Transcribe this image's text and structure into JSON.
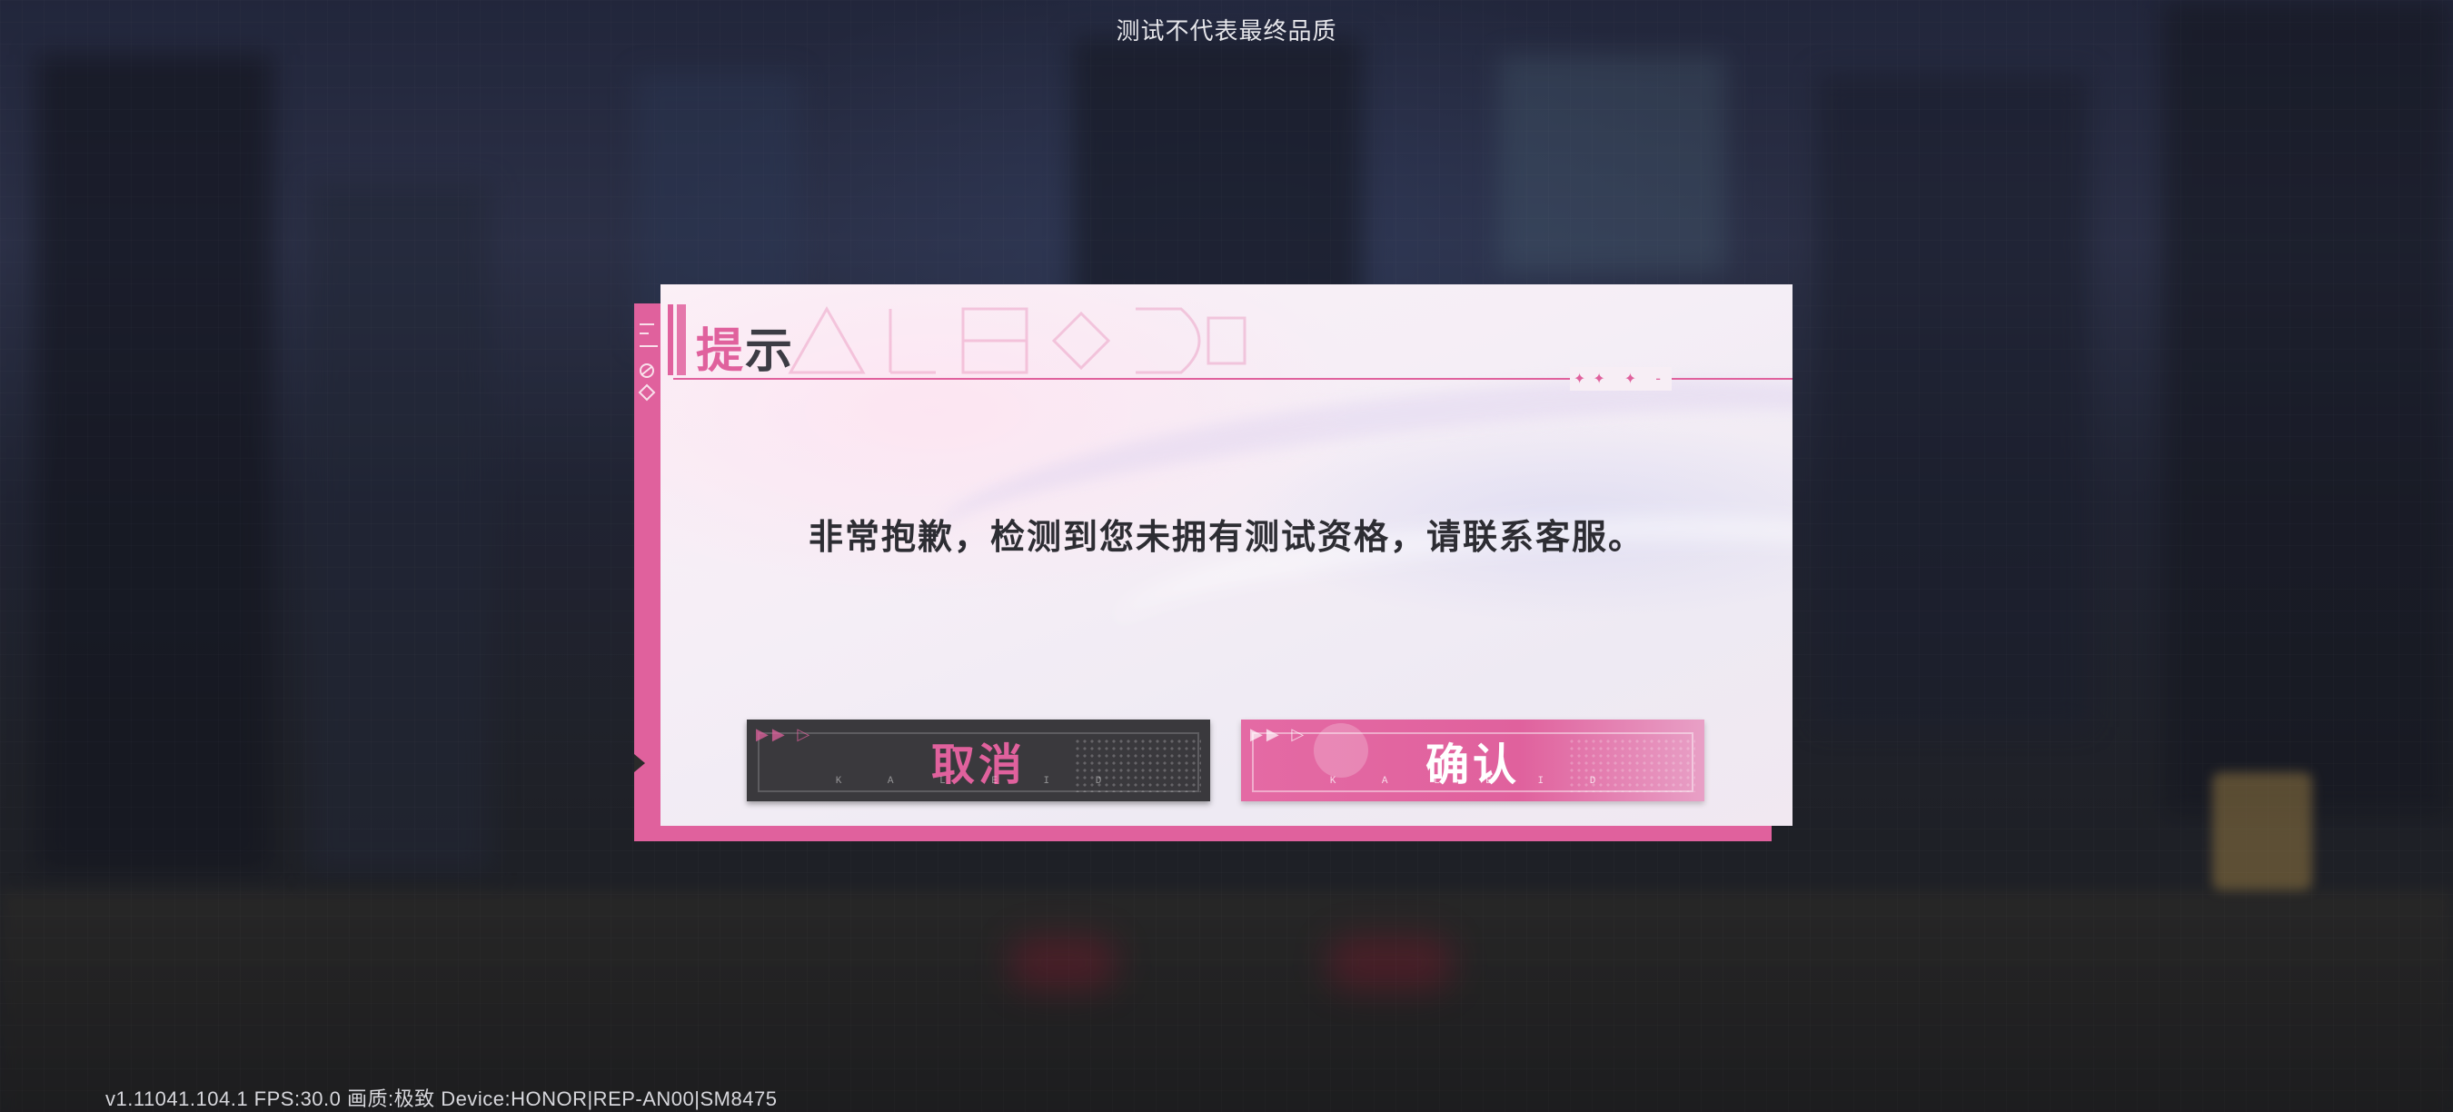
{
  "top_notice": "测试不代表最终品质",
  "version_info": "v1.11041.104.1 FPS:30.0 画质:极致 Device:HONOR|REP-AN00|SM8475",
  "dialog": {
    "title_first_char": "提",
    "title_rest": "示",
    "title_decoration_dots": "✦✦ ✦ -",
    "message": "非常抱歉，检测到您未拥有测试资格，请联系客服。",
    "cancel_label": "取消",
    "confirm_label": "确认",
    "button_subtext": "K A L E I D"
  },
  "colors": {
    "accent_pink": "#e0619d",
    "cancel_button_bg": "#3a393d",
    "text_dark": "#2d2d33"
  }
}
